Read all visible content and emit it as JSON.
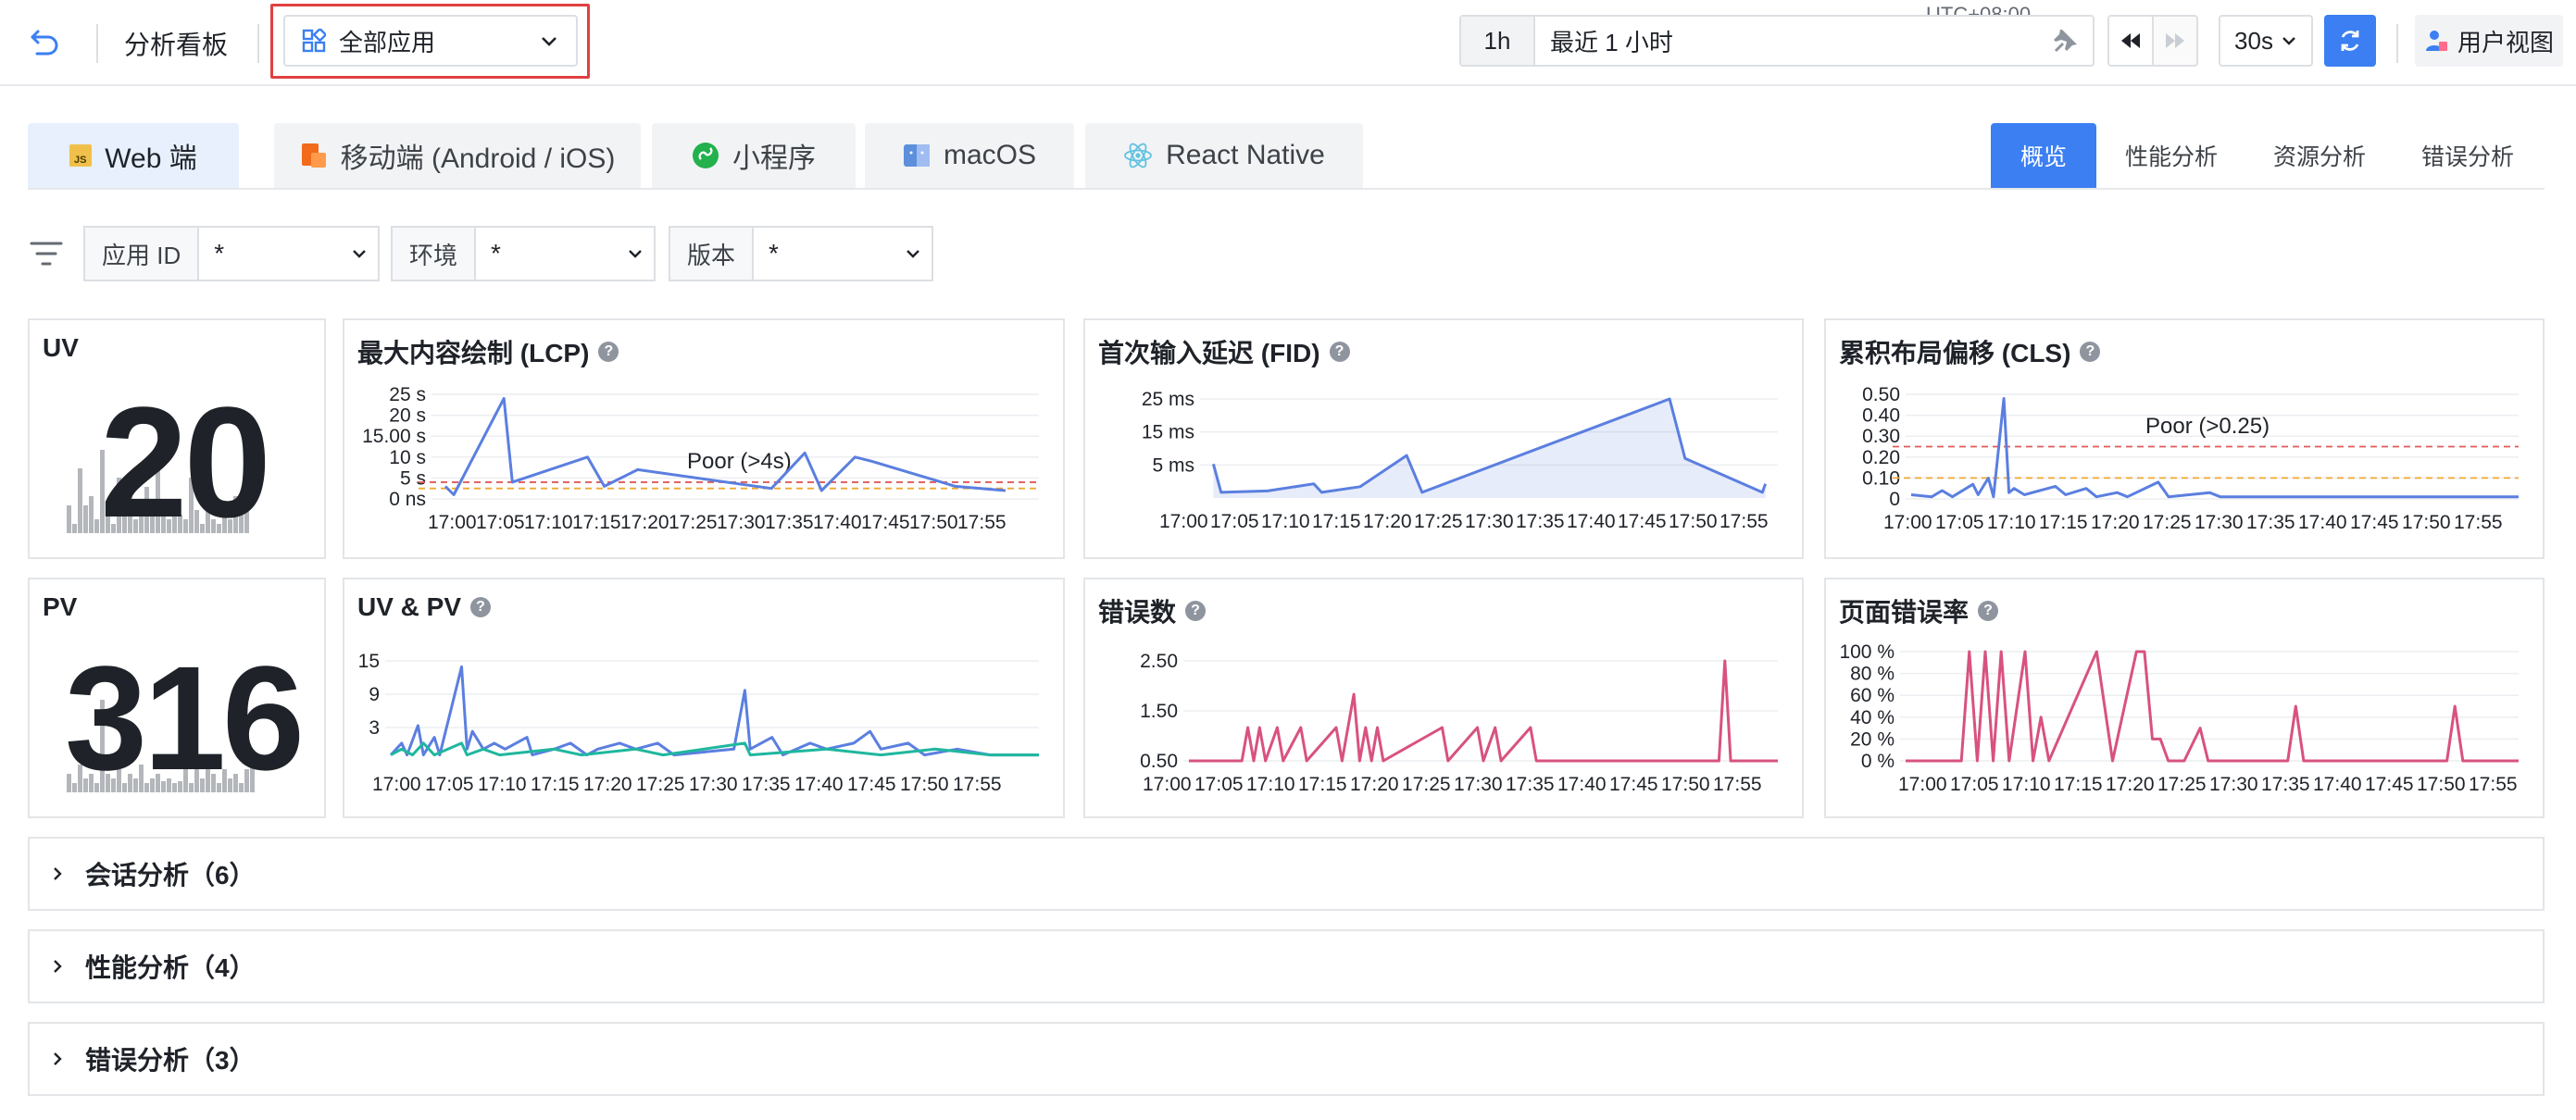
{
  "topbar": {
    "back_icon": "undo-arrow-icon",
    "title": "分析看板",
    "app_selector": {
      "icon": "grid-apps-icon",
      "value": "全部应用"
    },
    "timezone": "UTC+08:00",
    "time_range": {
      "quick": "1h",
      "label": "最近 1 小时"
    },
    "refresh_interval": "30s",
    "user_view_label": "用户视图"
  },
  "platform_tabs": [
    {
      "label": "Web 端",
      "icon": "js-icon",
      "active": true
    },
    {
      "label": "移动端 (Android / iOS)",
      "icon": "mobile-icon",
      "active": false
    },
    {
      "label": "小程序",
      "icon": "miniprogram-icon",
      "active": false
    },
    {
      "label": "macOS",
      "icon": "macos-icon",
      "active": false
    },
    {
      "label": "React Native",
      "icon": "react-icon",
      "active": false
    }
  ],
  "view_tabs": [
    {
      "label": "概览",
      "active": true
    },
    {
      "label": "性能分析",
      "active": false
    },
    {
      "label": "资源分析",
      "active": false
    },
    {
      "label": "错误分析",
      "active": false
    }
  ],
  "filters": [
    {
      "label": "应用 ID",
      "value": "*"
    },
    {
      "label": "环境",
      "value": "*"
    },
    {
      "label": "版本",
      "value": "*"
    }
  ],
  "stats": {
    "uv": {
      "label": "UV",
      "value": "20"
    },
    "pv": {
      "label": "PV",
      "value": "316"
    }
  },
  "x_ticks": [
    "17:00",
    "17:05",
    "17:10",
    "17:15",
    "17:20",
    "17:25",
    "17:30",
    "17:35",
    "17:40",
    "17:45",
    "17:50",
    "17:55"
  ],
  "chart_data": [
    {
      "id": "lcp",
      "type": "line",
      "title": "最大内容绘制 (LCP)",
      "y_ticks": [
        "25 s",
        "20 s",
        "15.00 s",
        "10 s",
        "5 s",
        "0 ns"
      ],
      "ylim": [
        0,
        25
      ],
      "annotation": "Poor (>4s)",
      "thresholds": [
        4,
        2.5
      ],
      "series": [
        {
          "color": "#5b7fe0",
          "points": [
            [
              0.5,
              3
            ],
            [
              1,
              1
            ],
            [
              4,
              24
            ],
            [
              4.5,
              4
            ],
            [
              9,
              10
            ],
            [
              10,
              3
            ],
            [
              12,
              7
            ],
            [
              20,
              2.5
            ],
            [
              22,
              11
            ],
            [
              23,
              2
            ],
            [
              25,
              10
            ],
            [
              26,
              9
            ],
            [
              31,
              3
            ],
            [
              34,
              2
            ]
          ]
        }
      ]
    },
    {
      "id": "fid",
      "type": "area",
      "title": "首次输入延迟 (FID)",
      "y_ticks": [
        "25 ms",
        "15 ms",
        "5 ms"
      ],
      "ylim": [
        0,
        35
      ],
      "series": [
        {
          "color": "#5b7fe0",
          "points": [
            [
              0.5,
              12
            ],
            [
              1,
              2
            ],
            [
              4,
              2.5
            ],
            [
              7,
              5
            ],
            [
              7.5,
              2
            ],
            [
              10,
              4
            ],
            [
              13,
              15
            ],
            [
              14,
              2
            ],
            [
              30,
              35
            ],
            [
              31,
              14
            ],
            [
              36,
              2
            ],
            [
              36.2,
              5
            ]
          ]
        }
      ]
    },
    {
      "id": "cls",
      "type": "line",
      "title": "累积布局偏移 (CLS)",
      "y_ticks": [
        "0.50",
        "0.40",
        "0.30",
        "0.20",
        "0.10",
        "0"
      ],
      "ylim": [
        0,
        0.5
      ],
      "annotation": "Poor (>0.25)",
      "thresholds": [
        0.25,
        0.1
      ],
      "series": [
        {
          "color": "#5b7fe0",
          "points": [
            [
              0,
              0.02
            ],
            [
              2,
              0.01
            ],
            [
              3,
              0.04
            ],
            [
              4,
              0.01
            ],
            [
              6,
              0.07
            ],
            [
              6.5,
              0.02
            ],
            [
              7.5,
              0.1
            ],
            [
              8,
              0.01
            ],
            [
              9,
              0.48
            ],
            [
              9.5,
              0.03
            ],
            [
              10,
              0.05
            ],
            [
              11,
              0.02
            ],
            [
              14,
              0.06
            ],
            [
              15,
              0.02
            ],
            [
              17,
              0.05
            ],
            [
              18,
              0.01
            ],
            [
              20,
              0.03
            ],
            [
              21,
              0.01
            ],
            [
              24,
              0.08
            ],
            [
              25,
              0.01
            ],
            [
              29,
              0.03
            ],
            [
              30,
              0.01
            ],
            [
              59,
              0.01
            ]
          ]
        }
      ]
    },
    {
      "id": "uvpv",
      "type": "line",
      "title": "UV & PV",
      "y_ticks": [
        "15",
        "9",
        "3"
      ],
      "ylim": [
        0,
        17
      ],
      "series": [
        {
          "color": "#5b7fe0",
          "points": [
            [
              0,
              1
            ],
            [
              2,
              3
            ],
            [
              3,
              1
            ],
            [
              5,
              6
            ],
            [
              6,
              1
            ],
            [
              8,
              4
            ],
            [
              9,
              1
            ],
            [
              13,
              16
            ],
            [
              14,
              2
            ],
            [
              15,
              5
            ],
            [
              17,
              2
            ],
            [
              19,
              3
            ],
            [
              21,
              2
            ],
            [
              25,
              4
            ],
            [
              26,
              1
            ],
            [
              30,
              2
            ],
            [
              33,
              3
            ],
            [
              36,
              1
            ],
            [
              38,
              2
            ],
            [
              42,
              3
            ],
            [
              45,
              2
            ],
            [
              49,
              3
            ],
            [
              52,
              1
            ],
            [
              63,
              2
            ],
            [
              65,
              12
            ],
            [
              66,
              2
            ],
            [
              70,
              4
            ],
            [
              72,
              1
            ],
            [
              77,
              3
            ],
            [
              80,
              2
            ],
            [
              85,
              3
            ],
            [
              88,
              5
            ],
            [
              90,
              2
            ],
            [
              95,
              3
            ],
            [
              98,
              1
            ],
            [
              104,
              2
            ],
            [
              110,
              1
            ],
            [
              119,
              1
            ]
          ]
        },
        {
          "color": "#1fb79e",
          "points": [
            [
              0,
              1
            ],
            [
              2,
              2
            ],
            [
              4,
              1
            ],
            [
              6,
              3
            ],
            [
              8,
              1
            ],
            [
              13,
              3
            ],
            [
              14,
              1
            ],
            [
              17,
              2
            ],
            [
              20,
              1
            ],
            [
              30,
              2
            ],
            [
              35,
              1
            ],
            [
              45,
              2
            ],
            [
              50,
              1
            ],
            [
              65,
              3
            ],
            [
              66,
              1
            ],
            [
              80,
              2
            ],
            [
              90,
              1
            ],
            [
              100,
              2
            ],
            [
              110,
              1
            ],
            [
              119,
              1
            ]
          ]
        }
      ]
    },
    {
      "id": "errors",
      "type": "line",
      "title": "错误数",
      "y_ticks": [
        "2.50",
        "1.50",
        "0.50"
      ],
      "ylim": [
        0,
        3
      ],
      "series": [
        {
          "color": "#d8527f",
          "points": [
            [
              0,
              0
            ],
            [
              9,
              0
            ],
            [
              10,
              1
            ],
            [
              11,
              0
            ],
            [
              12,
              1
            ],
            [
              13,
              0
            ],
            [
              15,
              1
            ],
            [
              16,
              0
            ],
            [
              19,
              1
            ],
            [
              20,
              0
            ],
            [
              25,
              1
            ],
            [
              26,
              0
            ],
            [
              28,
              2
            ],
            [
              29,
              0
            ],
            [
              30,
              1
            ],
            [
              31,
              0
            ],
            [
              32,
              1
            ],
            [
              33,
              0
            ],
            [
              43,
              1
            ],
            [
              44,
              0
            ],
            [
              49,
              1
            ],
            [
              50,
              0
            ],
            [
              52,
              1
            ],
            [
              53,
              0
            ],
            [
              58,
              1
            ],
            [
              59,
              0
            ],
            [
              90,
              0
            ],
            [
              91,
              3
            ],
            [
              92,
              0
            ],
            [
              100,
              0
            ]
          ]
        }
      ]
    },
    {
      "id": "errrate",
      "type": "line",
      "title": "页面错误率",
      "y_ticks": [
        "100 %",
        "80 %",
        "60 %",
        "40 %",
        "20 %",
        "0 %"
      ],
      "ylim": [
        0,
        100
      ],
      "series": [
        {
          "color": "#d8527f",
          "points": [
            [
              0,
              0
            ],
            [
              7,
              0
            ],
            [
              8,
              100
            ],
            [
              9,
              0
            ],
            [
              10,
              100
            ],
            [
              11,
              0
            ],
            [
              12,
              100
            ],
            [
              13,
              0
            ],
            [
              15,
              100
            ],
            [
              16,
              0
            ],
            [
              17,
              40
            ],
            [
              18,
              0
            ],
            [
              24,
              100
            ],
            [
              26,
              0
            ],
            [
              29,
              100
            ],
            [
              30,
              100
            ],
            [
              31,
              20
            ],
            [
              32,
              20
            ],
            [
              33,
              0
            ],
            [
              35,
              0
            ],
            [
              37,
              30
            ],
            [
              38,
              0
            ],
            [
              48,
              0
            ],
            [
              49,
              50
            ],
            [
              50,
              0
            ],
            [
              68,
              0
            ],
            [
              69,
              50
            ],
            [
              70,
              0
            ],
            [
              77,
              0
            ]
          ]
        }
      ]
    }
  ],
  "sections": [
    {
      "label": "会话分析（6）"
    },
    {
      "label": "性能分析（4）"
    },
    {
      "label": "错误分析（3）"
    }
  ]
}
